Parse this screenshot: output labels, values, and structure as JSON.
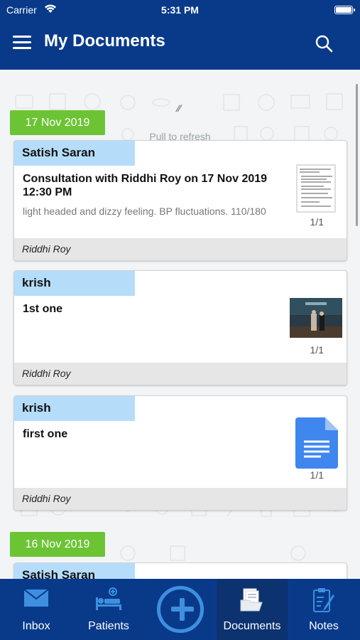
{
  "status_bar": {
    "carrier": "Carrier",
    "time": "5:31 PM"
  },
  "header": {
    "title": "My Documents"
  },
  "refresh": {
    "label": "Pull to refresh"
  },
  "groups": [
    {
      "date": "17 Nov 2019",
      "cards": [
        {
          "patient": "Satish Saran",
          "title": "Consultation with Riddhi Roy on 17 Nov 2019 12:30 PM",
          "description": "light headed and dizzy feeling. BP fluctuations. 110/180",
          "count": "1/1",
          "doctor": "Riddhi Roy",
          "thumbnail": "document-scan-icon"
        },
        {
          "patient": "krish",
          "title": "1st one",
          "description": "",
          "count": "1/1",
          "doctor": "Riddhi Roy",
          "thumbnail": "photo-icon"
        },
        {
          "patient": "krish",
          "title": "first one",
          "description": "",
          "count": "1/1",
          "doctor": "Riddhi Roy",
          "thumbnail": "google-doc-icon"
        }
      ]
    },
    {
      "date": "16 Nov 2019",
      "cards": [
        {
          "patient": "Satish Saran"
        }
      ]
    }
  ],
  "bottom_nav": {
    "items": [
      {
        "label": "Inbox",
        "icon": "envelope-icon"
      },
      {
        "label": "Patients",
        "icon": "patient-bed-icon"
      },
      {
        "label": "Documents",
        "icon": "documents-icon",
        "active": true
      },
      {
        "label": "Notes",
        "icon": "notes-icon"
      }
    ],
    "center_icon": "add-icon"
  },
  "colors": {
    "primary": "#093a8a",
    "date_chip": "#6cc435",
    "patient_tag": "#b5ddfa",
    "accent": "#3e8fe0"
  }
}
